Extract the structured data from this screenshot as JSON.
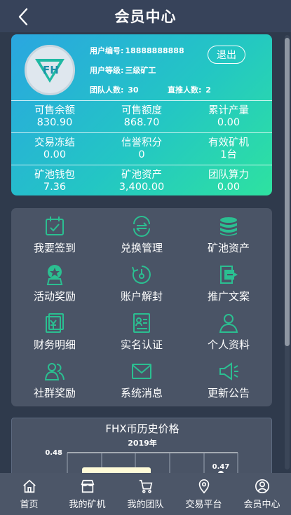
{
  "header": {
    "title": "会员中心"
  },
  "profile": {
    "user_id_label": "用户编号:",
    "user_id": "18888888888",
    "level_label": "用户等级:",
    "level": "三级矿工",
    "team_label": "团队人数:",
    "team_count": "30",
    "direct_label": "直推人数:",
    "direct_count": "2",
    "logout_label": "退出"
  },
  "stats": [
    [
      {
        "label": "可售余额",
        "value": "830.90"
      },
      {
        "label": "可售额度",
        "value": "868.70"
      },
      {
        "label": "累计产量",
        "value": "0.00"
      }
    ],
    [
      {
        "label": "交易冻结",
        "value": "0.00"
      },
      {
        "label": "信誉积分",
        "value": "0"
      },
      {
        "label": "有效矿机",
        "value": "1台"
      }
    ],
    [
      {
        "label": "矿池钱包",
        "value": "7.36"
      },
      {
        "label": "矿池资产",
        "value": "3,400.00"
      },
      {
        "label": "团队算力",
        "value": "0.00"
      }
    ]
  ],
  "menu": [
    {
      "label": "我要签到",
      "icon": "calendar-check-icon"
    },
    {
      "label": "兑换管理",
      "icon": "exchange-icon"
    },
    {
      "label": "矿池资产",
      "icon": "coin-stack-icon"
    },
    {
      "label": "活动奖励",
      "icon": "medal-icon"
    },
    {
      "label": "账户解封",
      "icon": "unlock-dial-icon"
    },
    {
      "label": "推广文案",
      "icon": "share-document-icon"
    },
    {
      "label": "财务明细",
      "icon": "finance-detail-icon"
    },
    {
      "label": "实名认证",
      "icon": "id-card-icon"
    },
    {
      "label": "个人资料",
      "icon": "person-icon"
    },
    {
      "label": "社群奖励",
      "icon": "group-icon"
    },
    {
      "label": "系统消息",
      "icon": "mail-icon"
    },
    {
      "label": "更新公告",
      "icon": "megaphone-icon"
    }
  ],
  "colors": {
    "accent": "#2ee2a0",
    "icon": "#2bbf91",
    "background": "#2f3a4c",
    "card": "#4a5466"
  },
  "chart_data": {
    "type": "line",
    "title": "FHX币历史价格",
    "subtitle": "2019年",
    "y_tick_labels": [
      "0.48"
    ],
    "data_labels": [
      "0.47"
    ],
    "series": [
      {
        "values": [
          0.47
        ]
      }
    ]
  },
  "tabbar": [
    {
      "label": "首页",
      "icon": "home-icon"
    },
    {
      "label": "我的矿机",
      "icon": "store-icon"
    },
    {
      "label": "我的团队",
      "icon": "cart-icon"
    },
    {
      "label": "交易平台",
      "icon": "location-pin-icon"
    },
    {
      "label": "会员中心",
      "icon": "user-circle-icon"
    }
  ]
}
